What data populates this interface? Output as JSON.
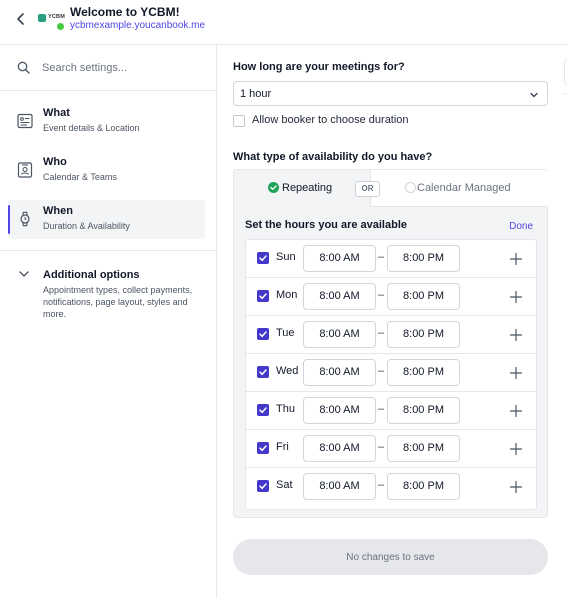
{
  "header": {
    "title": "Welcome to YCBM!",
    "link": "ycbmexample.youcanbook.me",
    "logo_text": "YCBM",
    "back_icon": "chevron-left-icon"
  },
  "sidebar": {
    "search_placeholder": "Search settings...",
    "items": [
      {
        "title": "What",
        "subtitle": "Event details & Location",
        "icon": "document-icon"
      },
      {
        "title": "Who",
        "subtitle": "Calendar & Teams",
        "icon": "contact-card-icon"
      },
      {
        "title": "When",
        "subtitle": "Duration & Availability",
        "icon": "watch-icon"
      }
    ],
    "additional": {
      "title": "Additional options",
      "subtitle": "Appointment types, collect payments, notifications, page layout, styles and more."
    }
  },
  "main": {
    "duration_label": "How long are your meetings for?",
    "duration_value": "1 hour",
    "allow_duration_label": "Allow booker to choose duration",
    "availability_label": "What type of availability do you have?",
    "tab_repeating": "Repeating",
    "or_label": "OR",
    "tab_calendar": "Calendar Managed",
    "hours_title": "Set the hours you are available",
    "done_label": "Done",
    "dash": "–",
    "days": [
      {
        "day": "Sun",
        "start": "8:00 AM",
        "end": "8:00 PM",
        "checked": true
      },
      {
        "day": "Mon",
        "start": "8:00 AM",
        "end": "8:00 PM",
        "checked": true
      },
      {
        "day": "Tue",
        "start": "8:00 AM",
        "end": "8:00 PM",
        "checked": true
      },
      {
        "day": "Wed",
        "start": "8:00 AM",
        "end": "8:00 PM",
        "checked": true
      },
      {
        "day": "Thu",
        "start": "8:00 AM",
        "end": "8:00 PM",
        "checked": true
      },
      {
        "day": "Fri",
        "start": "8:00 AM",
        "end": "8:00 PM",
        "checked": true
      },
      {
        "day": "Sat",
        "start": "8:00 AM",
        "end": "8:00 PM",
        "checked": true
      }
    ],
    "save_label": "No changes to save"
  },
  "colors": {
    "accent": "#4f46e5",
    "checkbox": "#4338ca",
    "success": "#22a35a",
    "logo_green": "#27a082"
  }
}
